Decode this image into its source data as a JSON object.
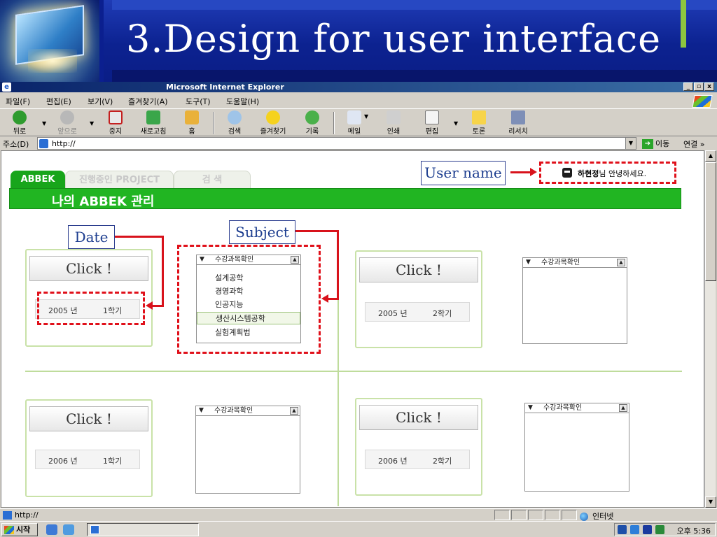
{
  "slide": {
    "title": "3.Design for user interface"
  },
  "window": {
    "title": "Microsoft Internet Explorer",
    "controls": [
      "_",
      "▫",
      "x"
    ]
  },
  "menu": [
    "파일(F)",
    "편집(E)",
    "보기(V)",
    "즐겨찾기(A)",
    "도구(T)",
    "도움말(H)"
  ],
  "toolbar": {
    "back": "뒤로",
    "forward": "앞으로",
    "stop": "중지",
    "refresh": "새로고침",
    "home": "홈",
    "search": "검색",
    "favorites": "즐겨찾기",
    "history": "기록",
    "mail": "메일",
    "print": "인쇄",
    "edit": "편집",
    "discuss": "토론",
    "research": "리서치"
  },
  "address": {
    "label": "주소(D)",
    "value": "http://",
    "go": "이동",
    "links": "연결 »"
  },
  "page": {
    "tabs": [
      "ABBEK",
      "진행중인 PROJECT",
      "검  색"
    ],
    "band_title": "나의 ABBEK 관리",
    "user_name": "하현정",
    "greeting": "님 안녕하세요."
  },
  "callouts": {
    "user_name": "User name",
    "date": "Date",
    "subject": "Subject"
  },
  "cards": [
    {
      "click": "Click !",
      "year": "2005 년",
      "term": "1학기"
    },
    {
      "click": "Click !",
      "year": "2005 년",
      "term": "2학기"
    },
    {
      "click": "Click !",
      "year": "2006 년",
      "term": "1학기"
    },
    {
      "click": "Click !",
      "year": "2006 년",
      "term": "2학기"
    }
  ],
  "subject_header": "수강과목확인",
  "subjects": [
    "설계공학",
    "경영과학",
    "인공지능",
    "생산시스템공학",
    "실험계획법"
  ],
  "selected_subject_index": 3,
  "status": {
    "left": "http://",
    "zone": "인터넷"
  },
  "taskbar": {
    "start": "시작",
    "clock": "오후 5:36"
  },
  "colors": {
    "green": "#21b522",
    "dash_red": "#e0101a",
    "callout_blue": "#1c3d8f"
  },
  "icons": [
    "ie-icon",
    "back-icon",
    "forward-icon",
    "stop-icon",
    "refresh-icon",
    "home-icon",
    "search-icon",
    "star-icon",
    "history-icon",
    "mail-icon",
    "print-icon",
    "edit-icon",
    "discuss-icon",
    "research-icon",
    "globe-icon",
    "windows-logo-icon",
    "user-icon"
  ]
}
